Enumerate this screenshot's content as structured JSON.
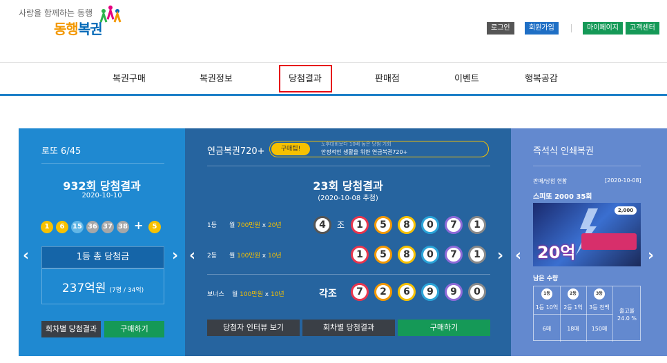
{
  "header": {
    "tagline": "사랑을 함께하는 동행",
    "logo_part1": "동행",
    "logo_part2": "복권",
    "login": "로그인",
    "signup": "회원가입",
    "mypage": "마이페이지",
    "customer": "고객센터"
  },
  "nav": {
    "items": [
      "복권구매",
      "복권정보",
      "당첨결과",
      "판매점",
      "이벤트",
      "행복공감"
    ]
  },
  "lotto": {
    "title": "로또 6/45",
    "round_title": "932회 당첨결과",
    "date": "2020-10-10",
    "balls": [
      "1",
      "6",
      "15",
      "36",
      "37",
      "38"
    ],
    "plus": "+",
    "bonus": "5",
    "prize_label": "1등 총 당첨금",
    "prize_amount": "237억원",
    "prize_detail": "(7명 / 34억)",
    "btn_results": "회차별 당첨결과",
    "btn_buy": "구매하기"
  },
  "pension": {
    "title": "연금복권720+",
    "tip_label": "구매팁!",
    "tip_line1": "노후대비보다 10배 높은 당첨 기회",
    "tip_line2": "안정적인 생활을 위한 연금복권720+",
    "round_title": "23회 당첨결과",
    "date": "(2020-10-08 추첨)",
    "r1_rank": "1등",
    "r1_desc_a": "월 ",
    "r1_desc_b": "700만원",
    "r1_desc_c": " x ",
    "r1_desc_d": "20년",
    "r1_group": "4",
    "r1_jo": "조",
    "r1_nums": [
      "1",
      "5",
      "8",
      "0",
      "7",
      "1"
    ],
    "r2_rank": "2등",
    "r2_desc_a": "월 ",
    "r2_desc_b": "100만원",
    "r2_desc_c": " x ",
    "r2_desc_d": "10년",
    "r2_nums": [
      "1",
      "5",
      "8",
      "0",
      "7",
      "1"
    ],
    "bonus_rank": "보너스",
    "bonus_desc_a": "월 ",
    "bonus_desc_b": "100만원",
    "bonus_desc_c": " x ",
    "bonus_desc_d": "10년",
    "bonus_group": "각조",
    "bonus_nums": [
      "7",
      "2",
      "6",
      "9",
      "9",
      "0"
    ],
    "btn_interview": "당첨자 인터뷰 보기",
    "btn_results": "회차별 당첨결과",
    "btn_buy": "구매하기"
  },
  "instant": {
    "title": "즉석식 인쇄복권",
    "status_label": "판매/당첨 현황",
    "status_date": "[2020-10-08]",
    "game": "스피또 2000 35회",
    "ticket_price": "2,000",
    "ticket_prize": "20억",
    "remain_label": "남은 수량",
    "cols": [
      {
        "badge": "1등",
        "label": "1등 10억",
        "count": "6매"
      },
      {
        "badge": "2등",
        "label": "2등 1억",
        "count": "18매"
      },
      {
        "badge": "3등",
        "label": "3등 천백",
        "count": "150매"
      }
    ],
    "rate_label": "출고율",
    "rate_value": "24.0 %"
  },
  "colors": {
    "lotto_bg": "#1f89d1",
    "pension_bg": "#26649f",
    "instant_bg": "#6389cf",
    "accent_red": "#e60012",
    "brand_orange": "#f39800",
    "brand_blue": "#0068b7"
  }
}
